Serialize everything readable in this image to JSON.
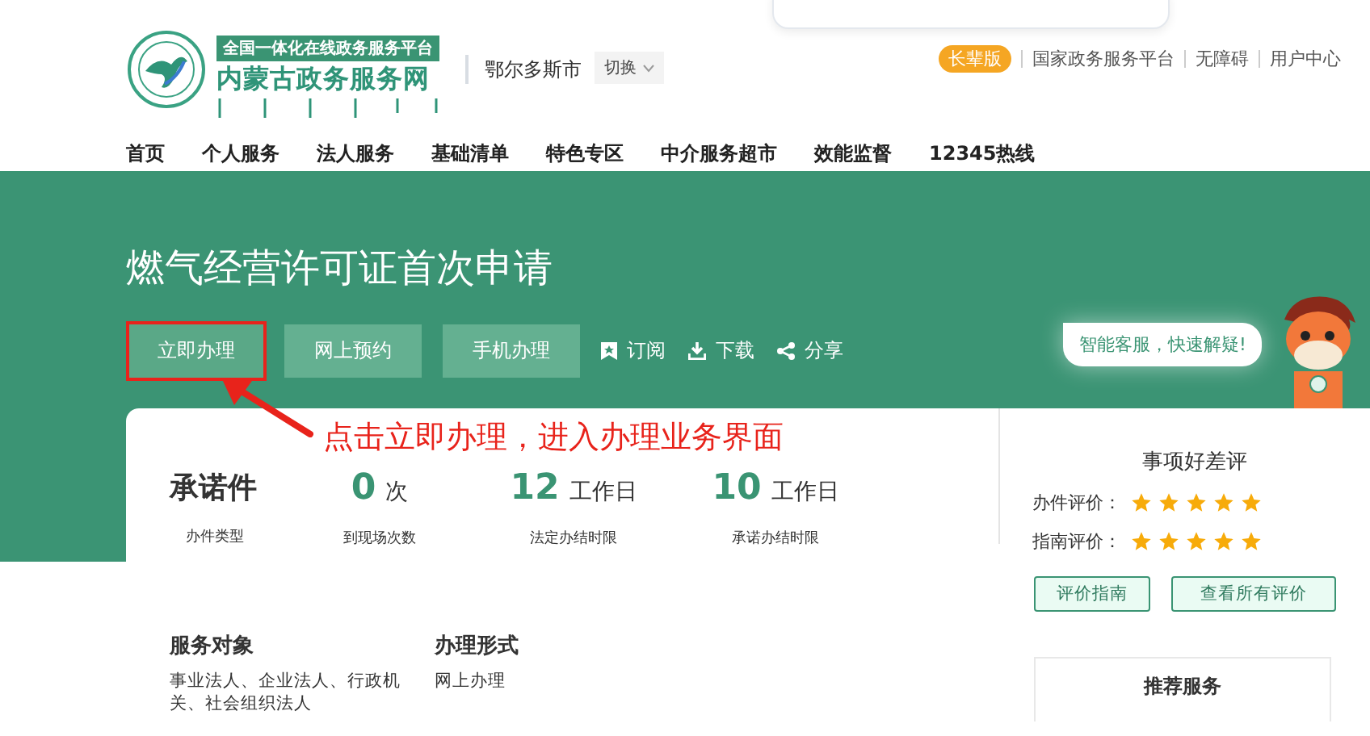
{
  "header": {
    "logo": {
      "slogan": "全国一体化在线政务服务平台",
      "name": "内蒙古政务服务网"
    },
    "region": "鄂尔多斯市",
    "switch_button": "切换",
    "links": [
      {
        "label": "长辈版",
        "kind": "badge"
      },
      {
        "label": "国家政务服务平台",
        "kind": "link"
      },
      {
        "label": "无障碍",
        "kind": "link"
      },
      {
        "label": "用户中心",
        "kind": "link"
      }
    ]
  },
  "nav": [
    "首页",
    "个人服务",
    "法人服务",
    "基础清单",
    "特色专区",
    "中介服务超市",
    "效能监督",
    "12345热线"
  ],
  "hero": {
    "title": "燃气经营许可证首次申请",
    "buttons": [
      {
        "label": "立即办理",
        "annotated": true
      },
      {
        "label": "网上预约",
        "annotated": false
      },
      {
        "label": "手机办理",
        "annotated": false
      }
    ],
    "actions": [
      {
        "label": "订阅",
        "kind": "bookmark"
      },
      {
        "label": "下载",
        "kind": "download"
      },
      {
        "label": "分享",
        "kind": "share"
      }
    ],
    "chat_bubble": "智能客服，快速解疑!"
  },
  "annotation": "点击立即办理，进入办理业务界面",
  "stats": [
    {
      "kind": "text",
      "value": "承诺件",
      "label": "办件类型"
    },
    {
      "kind": "number",
      "value": "0",
      "unit": "次",
      "label": "到现场次数"
    },
    {
      "kind": "number",
      "value": "12",
      "unit": "工作日",
      "label": "法定办结时限"
    },
    {
      "kind": "number",
      "value": "10",
      "unit": "工作日",
      "label": "承诺办结时限"
    }
  ],
  "info": [
    {
      "heading": "服务对象",
      "text": "事业法人、企业法人、行政机关、社会组织法人"
    },
    {
      "heading": "办理形式",
      "text": "网上办理"
    }
  ],
  "evaluation": {
    "title": "事项好差评",
    "ratings": [
      {
        "label": "办件评价：",
        "stars": 5
      },
      {
        "label": "指南评价：",
        "stars": 5
      }
    ],
    "buttons": [
      "评价指南",
      "查看所有评价"
    ]
  },
  "recommended": {
    "title": "推荐服务"
  }
}
